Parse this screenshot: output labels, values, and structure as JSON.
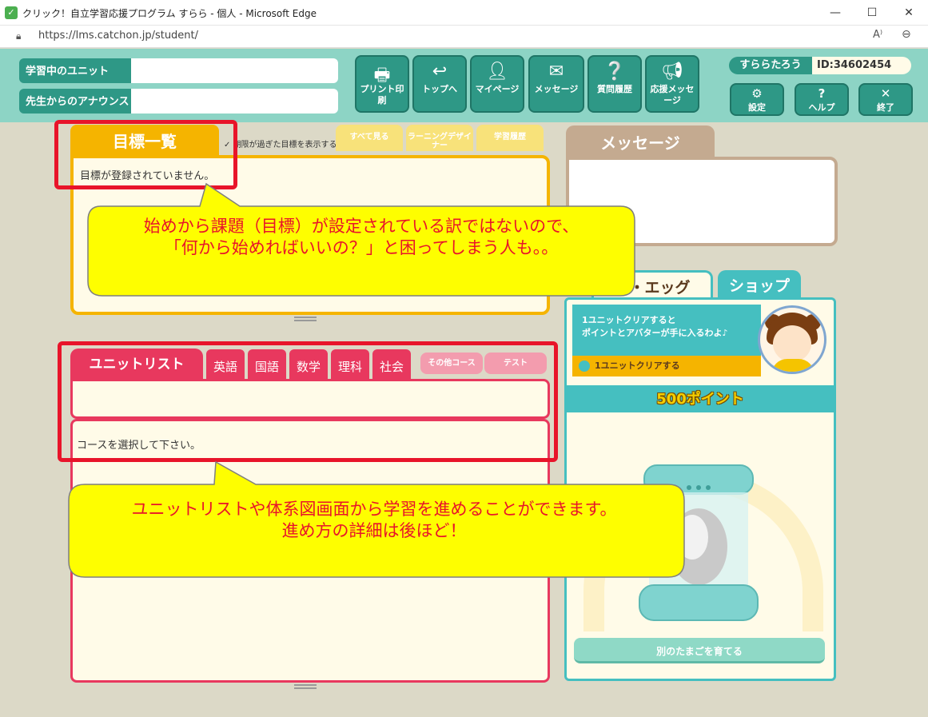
{
  "browser": {
    "window_title": "クリック！自立学習応援プログラム すらら - 個人 - Microsoft Edge",
    "url": "https://lms.catchon.jp/student/"
  },
  "header": {
    "studying_unit_label": "学習中のユニット",
    "announcement_label": "先生からのアナウンス",
    "nav": [
      {
        "label": "プリント印刷",
        "icon": "printer-icon"
      },
      {
        "label": "トップへ",
        "icon": "return-arrow-icon"
      },
      {
        "label": "マイページ",
        "icon": "person-icon"
      },
      {
        "label": "メッセージ",
        "icon": "envelope-icon"
      },
      {
        "label": "質問履歴",
        "icon": "question-bubble-icon"
      },
      {
        "label": "応援メッセージ",
        "icon": "megaphone-icon"
      }
    ],
    "user_name": "すららたろう",
    "user_id": "ID:34602454",
    "settings_label": "設定",
    "help_label": "ヘルプ",
    "exit_label": "終了"
  },
  "goals": {
    "tab_label": "目標一覧",
    "expired_checkbox_label": "期限が過ぎた目標を表示する",
    "view_all": "すべて見る",
    "learning_designer": "ラーニングデザイナー",
    "history": "学習履歴",
    "empty_text": "目標が登録されていません。"
  },
  "messages": {
    "tab_label": "メッセージ"
  },
  "avatar_panel": {
    "tab_egg": "ブ・エッグ",
    "tab_shop": "ショップ",
    "promo_line1": "1ユニットクリアすると",
    "promo_line2": "ポイントとアバターが手に入るわよ♪",
    "promo_action": "1ユニットクリアする",
    "points": "500ポイント",
    "grow_egg_button": "別のたまごを育てる"
  },
  "unit_list": {
    "tab_label": "ユニットリスト",
    "subjects": [
      "英語",
      "国語",
      "数学",
      "理科",
      "社会"
    ],
    "other_courses": "その他コース",
    "test": "テスト",
    "select_prompt": "コースを選択して下さい。"
  },
  "callouts": {
    "goals_line1": "始めから課題（目標）が設定されている訳ではないので、",
    "goals_line2": "「何から始めればいいの？」と困ってしまう人も。。",
    "unit_line1": "ユニットリストや体系図画面から学習を進めることができます。",
    "unit_line2": "進め方の詳細は後ほど！"
  },
  "colors": {
    "teal": "#2e9886",
    "header_bg": "#8dd4c5",
    "goals_yellow": "#f5b400",
    "unit_pink": "#e8385e",
    "highlight_red": "#e8142a",
    "callout_yellow": "#fefe00"
  }
}
